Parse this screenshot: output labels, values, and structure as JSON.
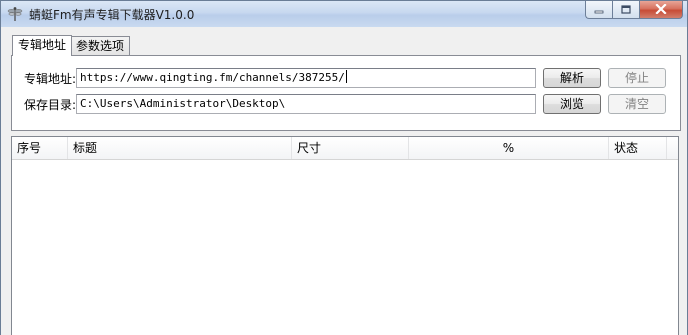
{
  "window": {
    "title": "蜻蜓Fm有声专辑下载器V1.0.0"
  },
  "tabs": [
    {
      "label": "专辑地址"
    },
    {
      "label": "参数选项"
    }
  ],
  "form": {
    "album_label": "专辑地址:",
    "album_value": "https://www.qingting.fm/channels/387255/",
    "save_label": "保存目录:",
    "save_value": "C:\\Users\\Administrator\\Desktop\\"
  },
  "buttons": {
    "parse": "解析",
    "stop": "停止",
    "browse": "浏览",
    "clear": "清空"
  },
  "table": {
    "columns": [
      "序号",
      "标题",
      "尺寸",
      "%",
      "状态"
    ],
    "rows": []
  }
}
